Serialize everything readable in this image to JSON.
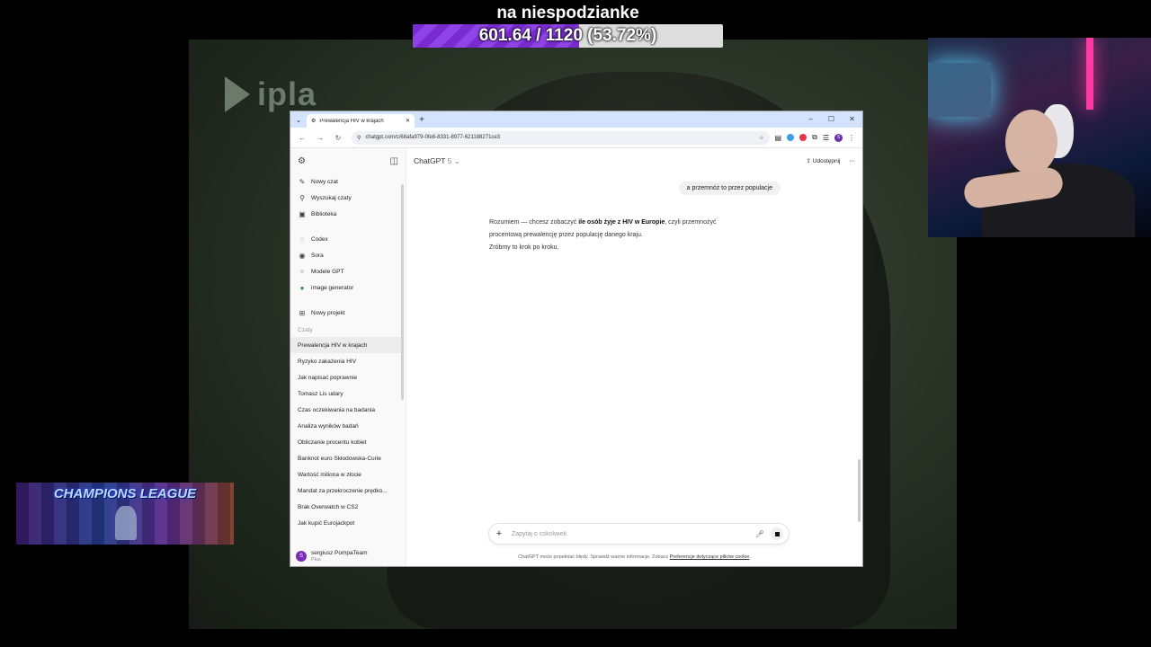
{
  "overlay": {
    "goal_title": "na niespodzianke",
    "goal_text": "601.64 / 1120 (53.72%)",
    "goal_fraction": 0.5372,
    "goal_color": "#7a2bd0",
    "ipla_logo": "ipla",
    "banner_text": "CHAMPIONS LEAGUE"
  },
  "browser": {
    "tab_title": "Prewalencja HIV w krajach",
    "url": "chatgpt.com/c/68afa979-0fe8-8331-8977-621188271ce3"
  },
  "sidebar": {
    "top_items": [
      {
        "label": "Nowy czat",
        "icon": "edit-icon"
      },
      {
        "label": "Wyszukaj czaty",
        "icon": "search-icon"
      },
      {
        "label": "Biblioteka",
        "icon": "library-icon"
      }
    ],
    "tools": [
      {
        "label": "Codex",
        "icon": "codex-icon"
      },
      {
        "label": "Sora",
        "icon": "sora-icon"
      },
      {
        "label": "Modele GPT",
        "icon": "gpts-icon"
      },
      {
        "label": "image generator",
        "icon": "image-gen-icon"
      }
    ],
    "project": {
      "label": "Nowy projekt",
      "icon": "folder-icon"
    },
    "section_label": "Czaty",
    "chats": [
      "Prewalencja HIV w krajach",
      "Ryzyko zakażenia HIV",
      "Jak napisać poprawnie",
      "Tomasz Lis udary",
      "Czas oczekiwania na badania",
      "Analiza wyników badań",
      "Obliczanie procentu kobiet",
      "Banknot euro Skłodowska-Curie",
      "Wartość miliona w złocie",
      "Mandat za przekroczenie prędko...",
      "Brak Overwatch w CS2",
      "Jak kupić Eurojackpot"
    ],
    "user": {
      "initial": "S",
      "name": "sergiusz PompaTeam",
      "plan": "Plus"
    }
  },
  "main": {
    "model_name": "ChatGPT",
    "model_version": "5",
    "share_label": "Udostępnij",
    "user_message": "a przemnóż to przez populacje",
    "assistant": {
      "line1_pre": "Rozumiem — chcesz zobaczyć ",
      "line1_bold": "ile osób żyje z HIV w Europie",
      "line1_post": ", czyli przemnożyć",
      "line2": "procentową prewalencję przez populację danego kraju.",
      "line3": "Zróbmy to krok po kroku."
    },
    "composer_placeholder": "Zapytaj o cokolwiek",
    "disclaimer_pre": "ChatGPT może popełniać błędy. Sprawdź ważne informacje. Zobacz ",
    "disclaimer_link": "Preferencje dotyczące plików cookie",
    "disclaimer_post": "."
  }
}
